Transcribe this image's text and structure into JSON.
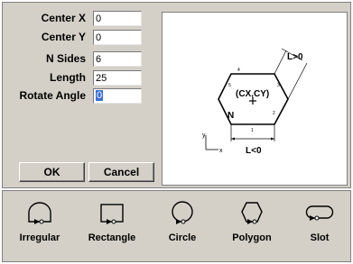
{
  "form": {
    "center_x": {
      "label": "Center X",
      "value": "0"
    },
    "center_y": {
      "label": "Center Y",
      "value": "0"
    },
    "n_sides": {
      "label": "N Sides",
      "value": "6"
    },
    "length": {
      "label": "Length",
      "value": "25"
    },
    "rotate_angle": {
      "label": "Rotate Angle",
      "value": "0"
    }
  },
  "buttons": {
    "ok": "OK",
    "cancel": "Cancel"
  },
  "preview": {
    "l_positive": "L>0",
    "l_negative": "L<0",
    "center": "(CX,CY)",
    "n_label": "N",
    "axis_y": "y",
    "axis_x": "x",
    "vertex_numbers": [
      "1",
      "2",
      "3",
      "4",
      "5"
    ]
  },
  "shapes": [
    {
      "label": "Irregular",
      "icon": "irregular-shape-icon"
    },
    {
      "label": "Rectangle",
      "icon": "rectangle-shape-icon"
    },
    {
      "label": "Circle",
      "icon": "circle-shape-icon"
    },
    {
      "label": "Polygon",
      "icon": "polygon-shape-icon"
    },
    {
      "label": "Slot",
      "icon": "slot-shape-icon"
    }
  ]
}
